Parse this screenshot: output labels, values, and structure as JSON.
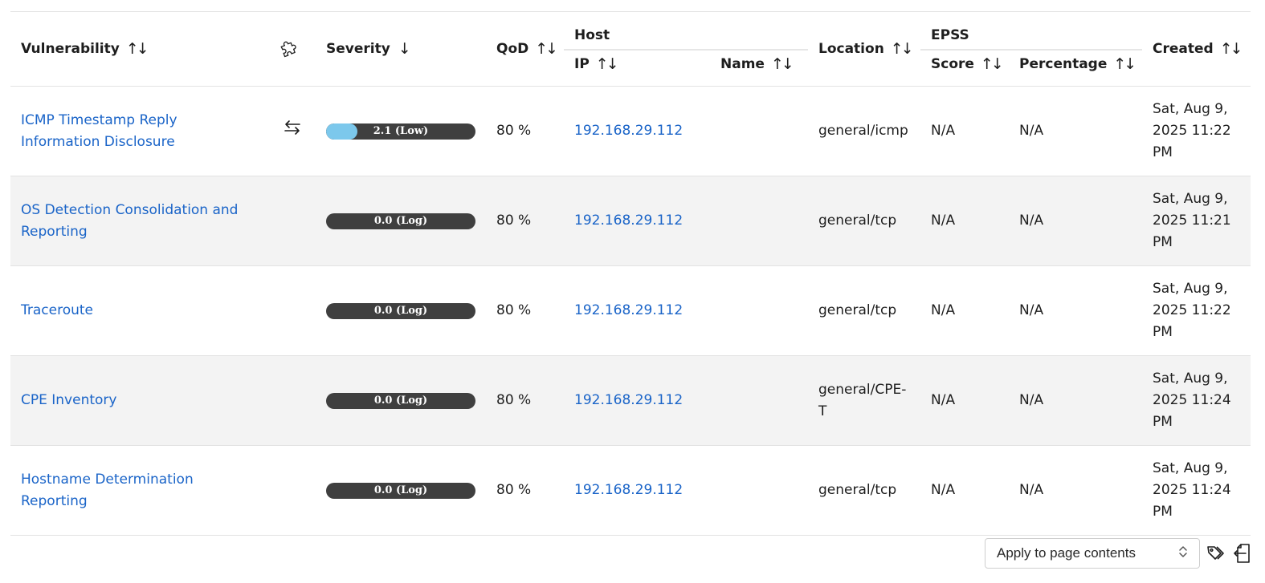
{
  "columns": {
    "vulnerability": "Vulnerability",
    "severity": "Severity",
    "qod": "QoD",
    "host": "Host",
    "ip": "IP",
    "name": "Name",
    "location": "Location",
    "epss": "EPSS",
    "score": "Score",
    "percentage": "Percentage",
    "created": "Created"
  },
  "icons": {
    "sort": "sort-up-down-icon",
    "sort_desc": "arrow-down-icon",
    "solution_type": "puzzle-icon",
    "delta": "swap-arrows-icon",
    "tag": "tag-icon",
    "export": "export-icon"
  },
  "colors": {
    "link": "#1a64c8",
    "severity_bar_bg": "#3f3f3f",
    "severity_low": "#7cc8ec",
    "row_alt": "#f3f3f3"
  },
  "rows": [
    {
      "vulnerability_line1": "ICMP Timestamp Reply",
      "vulnerability_line2": "Information Disclosure",
      "severity_label": "2.1 (Low)",
      "severity_value": 2.1,
      "qod": "80 %",
      "ip": "192.168.29.112",
      "name": "",
      "location_line1": "general/icmp",
      "location_line2": "",
      "epss_score": "N/A",
      "epss_percentage": "N/A",
      "created_line1": "Sat, Aug 9,",
      "created_line2": "2025 11:22",
      "created_line3": "PM"
    },
    {
      "vulnerability_line1": "OS Detection Consolidation and",
      "vulnerability_line2": "Reporting",
      "severity_label": "0.0 (Log)",
      "severity_value": 0.0,
      "qod": "80 %",
      "ip": "192.168.29.112",
      "name": "",
      "location_line1": "general/tcp",
      "location_line2": "",
      "epss_score": "N/A",
      "epss_percentage": "N/A",
      "created_line1": "Sat, Aug 9,",
      "created_line2": "2025 11:21",
      "created_line3": "PM"
    },
    {
      "vulnerability_line1": "Traceroute",
      "vulnerability_line2": "",
      "severity_label": "0.0 (Log)",
      "severity_value": 0.0,
      "qod": "80 %",
      "ip": "192.168.29.112",
      "name": "",
      "location_line1": "general/tcp",
      "location_line2": "",
      "epss_score": "N/A",
      "epss_percentage": "N/A",
      "created_line1": "Sat, Aug 9,",
      "created_line2": "2025 11:22",
      "created_line3": "PM"
    },
    {
      "vulnerability_line1": "CPE Inventory",
      "vulnerability_line2": "",
      "severity_label": "0.0 (Log)",
      "severity_value": 0.0,
      "qod": "80 %",
      "ip": "192.168.29.112",
      "name": "",
      "location_line1": "general/CPE-",
      "location_line2": "T",
      "epss_score": "N/A",
      "epss_percentage": "N/A",
      "created_line1": "Sat, Aug 9,",
      "created_line2": "2025 11:24",
      "created_line3": "PM"
    },
    {
      "vulnerability_line1": "Hostname Determination",
      "vulnerability_line2": "Reporting",
      "severity_label": "0.0 (Log)",
      "severity_value": 0.0,
      "qod": "80 %",
      "ip": "192.168.29.112",
      "name": "",
      "location_line1": "general/tcp",
      "location_line2": "",
      "epss_score": "N/A",
      "epss_percentage": "N/A",
      "created_line1": "Sat, Aug 9,",
      "created_line2": "2025 11:24",
      "created_line3": "PM"
    }
  ],
  "footer": {
    "bulk_select_value": "Apply to page contents"
  }
}
